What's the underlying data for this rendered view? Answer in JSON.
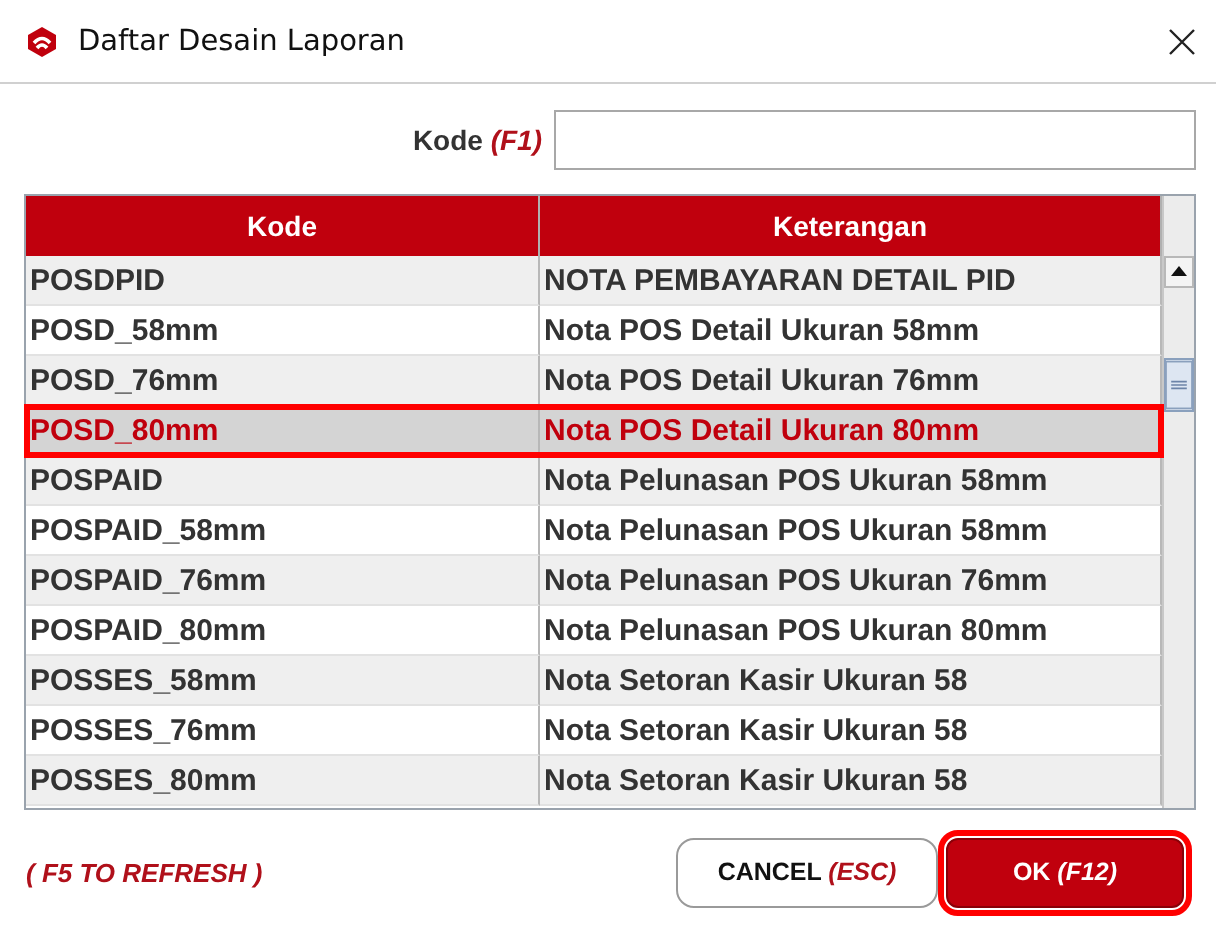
{
  "window": {
    "title": "Daftar Desain Laporan"
  },
  "filter": {
    "label": "Kode *(F1)*"
  },
  "table": {
    "columns": [
      "Kode",
      "Keterangan"
    ],
    "rows": [
      {
        "cells": [
          "POSDPID",
          "NOTA PEMBAYARAN DETAIL PID"
        ],
        "selected": false
      },
      {
        "cells": [
          "POSD_58mm",
          "Nota POS Detail Ukuran 58mm"
        ],
        "selected": false
      },
      {
        "cells": [
          "POSD_76mm",
          "Nota POS Detail Ukuran 76mm"
        ],
        "selected": false
      },
      {
        "cells": [
          "POSD_80mm",
          "Nota POS Detail Ukuran 80mm"
        ],
        "selected": true
      },
      {
        "cells": [
          "POSPAID",
          "Nota Pelunasan POS Ukuran 58mm"
        ],
        "selected": false
      },
      {
        "cells": [
          "POSPAID_58mm",
          "Nota Pelunasan POS Ukuran 58mm"
        ],
        "selected": false
      },
      {
        "cells": [
          "POSPAID_76mm",
          "Nota Pelunasan POS Ukuran 76mm"
        ],
        "selected": false
      },
      {
        "cells": [
          "POSPAID_80mm",
          "Nota Pelunasan POS Ukuran 80mm"
        ],
        "selected": false
      },
      {
        "cells": [
          "POSSES_58mm",
          "Nota Setoran Kasir Ukuran 58"
        ],
        "selected": false
      },
      {
        "cells": [
          "POSSES_76mm",
          "Nota Setoran Kasir Ukuran 58"
        ],
        "selected": false
      },
      {
        "cells": [
          "POSSES_80mm",
          "Nota Setoran Kasir Ukuran 58"
        ],
        "selected": false
      }
    ]
  },
  "hint": "( F5 TO REFRESH )",
  "buttons": [
    {
      "label": "CANCEL *(ESC)*",
      "kind": "secondary",
      "focused": false
    },
    {
      "label": "OK *(F12)*",
      "kind": "primary",
      "focused": true
    }
  ]
}
